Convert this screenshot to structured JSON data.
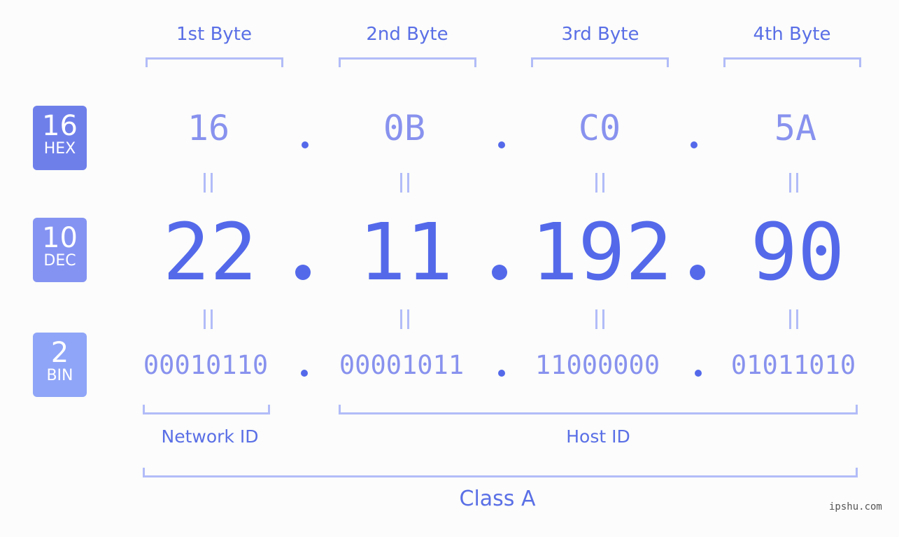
{
  "byte_headers": [
    "1st Byte",
    "2nd Byte",
    "3rd Byte",
    "4th Byte"
  ],
  "badges": {
    "hex": {
      "number": "16",
      "label": "HEX",
      "color": "#6f7fea"
    },
    "dec": {
      "number": "10",
      "label": "DEC",
      "color": "#8493f2"
    },
    "bin": {
      "number": "2",
      "label": "BIN",
      "color": "#8fa5f7"
    }
  },
  "hex_values": [
    "16",
    "0B",
    "C0",
    "5A"
  ],
  "dec_values": [
    "22",
    "11",
    "192",
    "90"
  ],
  "bin_values": [
    "00010110",
    "00001011",
    "11000000",
    "01011010"
  ],
  "sections": {
    "network_id": "Network ID",
    "host_id": "Host ID",
    "class": "Class A"
  },
  "watermark": "ipshu.com",
  "colors": {
    "accent": "#5469ea",
    "light_accent": "#8892ee",
    "bracket": "#b2bcf8",
    "background": "#fbfcfb"
  }
}
